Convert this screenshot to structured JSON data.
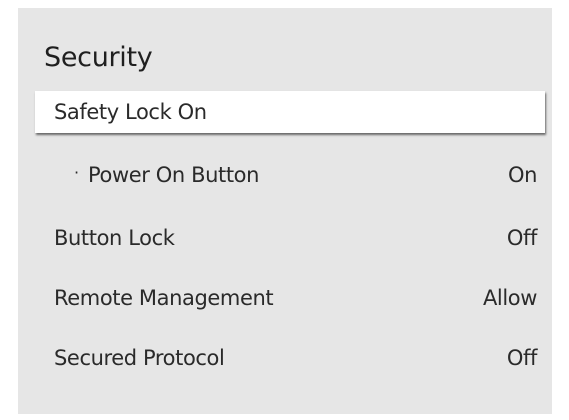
{
  "header": {
    "title": "Security"
  },
  "menu": {
    "items": [
      {
        "label": "Safety Lock On",
        "value": ""
      },
      {
        "label": "Power On Button",
        "value": "On",
        "bullet": "·"
      },
      {
        "label": "Button Lock",
        "value": "Off"
      },
      {
        "label": "Remote Management",
        "value": "Allow"
      },
      {
        "label": "Secured Protocol",
        "value": "Off"
      }
    ]
  },
  "colors": {
    "panel_background": "#e6e6e6",
    "focused_background": "#ffffff",
    "text": "#2a2a2a"
  }
}
